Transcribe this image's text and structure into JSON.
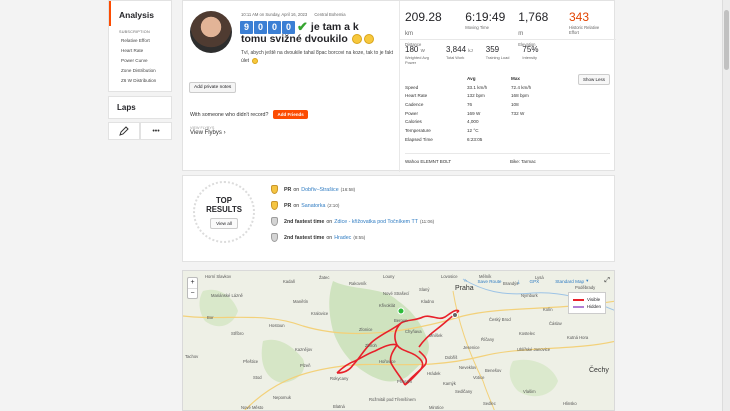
{
  "sidebar": {
    "title": "Analysis",
    "subscription_label": "SUBSCRIPTION",
    "items": [
      "Relative Effort",
      "Heart Rate",
      "Power Curve",
      "Zone Distribution",
      "Z6 W Distribution"
    ],
    "laps_label": "Laps",
    "more_label": "•••"
  },
  "activity": {
    "datetime": "10:11 AM on Sunday, April 16, 2023",
    "location": "Central Bohemia",
    "title_digits": [
      "9",
      "0",
      "0",
      "0"
    ],
    "title_rest": "je tam a k",
    "title_line2": "tomu svižné dvoukilo",
    "description": "Tvl, abych ještě na dvoukile tahal 8pac borcovi na koze, tak to je fakt úlet",
    "add_notes": "Add private notes",
    "with_someone": "With someone who didn't record?",
    "add_friends": "Add Friends",
    "flyby_label": "VIEW FLYBYS",
    "flyby": "View Flybys"
  },
  "stats": {
    "distance": {
      "value": "209.28",
      "unit": "km",
      "label": "Distance"
    },
    "moving_time": {
      "value": "6:19:49",
      "label": "Moving Time"
    },
    "elevation": {
      "value": "1,768",
      "unit": "m",
      "label": "Elevation"
    },
    "relative_effort": {
      "value": "343",
      "label": "Historic Relative Effort"
    },
    "weighted_power": {
      "value": "180",
      "unit": "W",
      "label": "Weighted Avg Power"
    },
    "total_work": {
      "value": "3,844",
      "unit": "kJ",
      "label": "Total Work"
    },
    "training_load": {
      "value": "359",
      "label": "Training Load"
    },
    "intensity": {
      "value": "75%",
      "label": "Intensity"
    },
    "show_less": "Show Less",
    "table_head": {
      "avg": "Avg",
      "max": "Max"
    },
    "rows": [
      {
        "k": "Speed",
        "a": "33.1 km/h",
        "m": "72.4 km/h"
      },
      {
        "k": "Heart Rate",
        "a": "132 bpm",
        "m": "168 bpm"
      },
      {
        "k": "Cadence",
        "a": "76",
        "m": "108"
      },
      {
        "k": "Power",
        "a": "169 W",
        "m": "732 W"
      },
      {
        "k": "Calories",
        "a": "4,000",
        "m": ""
      },
      {
        "k": "Temperature",
        "a": "12 °C",
        "m": ""
      },
      {
        "k": "Elapsed Time",
        "a": "6:23:05",
        "m": ""
      }
    ],
    "device": "Wahoo ELEMNT BOLT",
    "bike": "Bike: Tarmac"
  },
  "results": {
    "title_line1": "TOP",
    "title_line2": "RESULTS",
    "view_all": "View all",
    "items": [
      {
        "prefix": "PR",
        "mid": "on",
        "segment": "Dobřiv–Strašice",
        "time": "(16:58)"
      },
      {
        "prefix": "PR",
        "mid": "on",
        "segment": "Sanatorka",
        "time": "(2:10)"
      },
      {
        "prefix": "2nd fastest time",
        "mid": "on",
        "segment": "Zdice - křižovatka pod Točníkem TT",
        "time": "(11:06)"
      },
      {
        "prefix": "2nd fastest time",
        "mid": "on",
        "segment": "Hradec",
        "time": "(8:55)"
      }
    ]
  },
  "map": {
    "save_route": "Save Route",
    "gpx": "GPX",
    "map_type": "Standard Map",
    "legend_visible": "Visible",
    "legend_hidden": "Hidden",
    "route_color": "#e8202a",
    "hidden_color": "#b07fd4",
    "labels": {
      "horni_slavkov": "Horní Slavkov",
      "rakovnik": "Rakovník",
      "lovosice": "Lovosice",
      "kralovice": "Kralovice",
      "kladno": "Kladno",
      "praha": "Praha",
      "tachov": "Tachov",
      "plzen": "Plzeň",
      "rokycany": "Rokycany",
      "beroun": "Beroun",
      "pribram": "Příbram",
      "benesov": "Benešov",
      "cechy": "Čechy",
      "rozmital": "Rožmitál pod Třemšínem",
      "kutna_hora": "Kutná Hora",
      "kolin": "Kolín",
      "sedlcany": "Sedlčany",
      "vlasim": "Vlašim",
      "blatna": "Blatná",
      "marianske": "Mariánské Lázně",
      "stribro": "Stříbro",
      "nepomuk": "Nepomuk",
      "hostoun": "Hostoun",
      "zbiroh": "Zbiroh",
      "horovice": "Hořovice",
      "dobris": "Dobříš",
      "ricany": "Říčany",
      "slany": "Slaný",
      "melnik": "Mělník",
      "nymburk": "Nymburk",
      "brandys": "Brandýs",
      "podebrady": "Poděbrady",
      "caslav": "Čáslav",
      "uhlirske": "Uhlířské Janovice",
      "votice": "Votice",
      "cesky_brod": "Český Brod",
      "nove_straseci": "Nové Strašecí",
      "kadan": "Kadaň",
      "zatec": "Žatec",
      "louny": "Louny",
      "hradek": "Hrádek",
      "mnisek": "Mníšek",
      "kaznejov": "Kaznějov",
      "manetin": "Manětín",
      "bor": "Bor",
      "stod": "Stod",
      "mirotice": "Mirotice",
      "nove_mesto": "Nové Město",
      "prestice": "Přeštice",
      "krivoklat": "Křivoklát",
      "lysa": "Lysá",
      "kostelec": "Kostelec",
      "jesenice": "Jesenice",
      "neveklov": "Neveklov",
      "chynava": "Chyňava",
      "kamycka": "Kamýk",
      "sedlec": "Sedlec",
      "hlinsko": "Hlinsko",
      "zlonice": "Zlonice"
    }
  }
}
